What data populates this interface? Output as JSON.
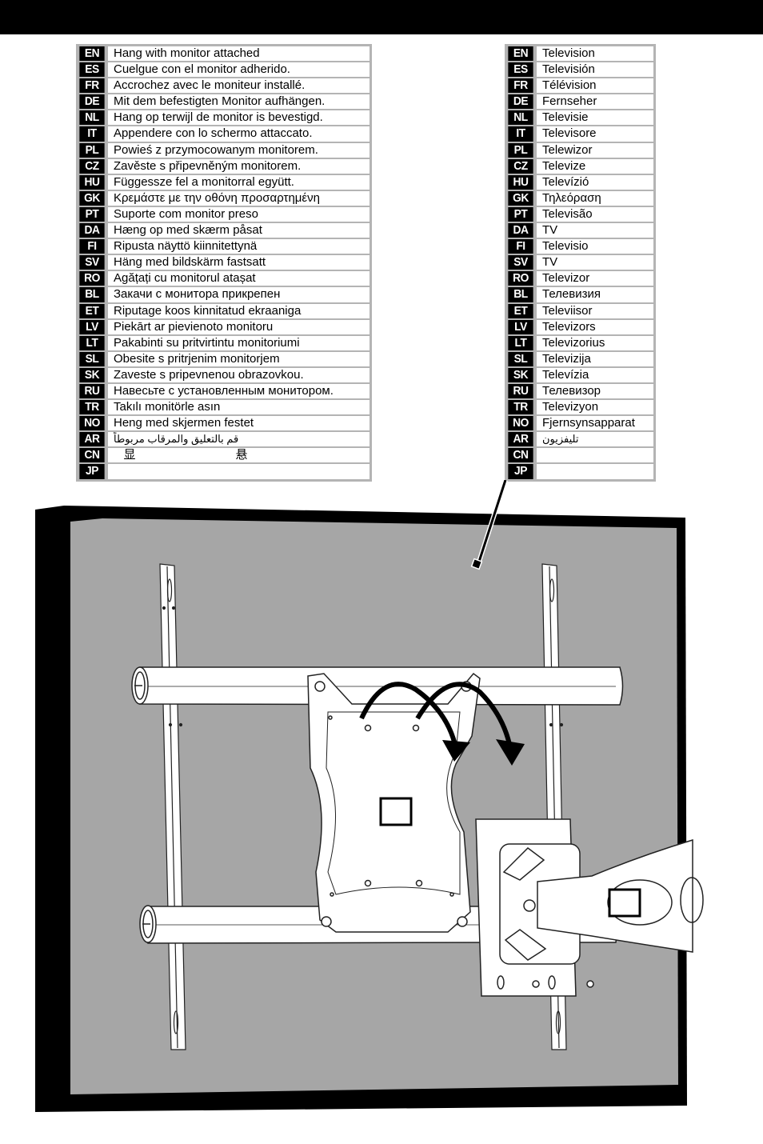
{
  "page": {
    "topbar_color": "#000000"
  },
  "left_table": {
    "title": "Hang with monitor attached",
    "rows": [
      {
        "code": "EN",
        "text": "Hang with monitor attached"
      },
      {
        "code": "ES",
        "text": "Cuelgue con el monitor adherido."
      },
      {
        "code": "FR",
        "text": "Accrochez avec le moniteur installé."
      },
      {
        "code": "DE",
        "text": "Mit dem befestigten Monitor aufhängen."
      },
      {
        "code": "NL",
        "text": "Hang op terwijl de monitor is bevestigd."
      },
      {
        "code": "IT",
        "text": "Appendere con lo schermo attaccato."
      },
      {
        "code": "PL",
        "text": "Powieś z przymocowanym monitorem."
      },
      {
        "code": "CZ",
        "text": "Zavěste s připevněným monitorem."
      },
      {
        "code": "HU",
        "text": "Függessze fel a monitorral együtt."
      },
      {
        "code": "GK",
        "text": "Κρεμάστε με την οθόνη προσαρτημένη"
      },
      {
        "code": "PT",
        "text": "Suporte com monitor preso"
      },
      {
        "code": "DA",
        "text": "Hæng op med skærm påsat"
      },
      {
        "code": "FI",
        "text": "Ripusta näyttö kiinnitettynä"
      },
      {
        "code": "SV",
        "text": "Häng med bildskärm fastsatt"
      },
      {
        "code": "RO",
        "text": "Agățați cu monitorul atașat"
      },
      {
        "code": "BL",
        "text": "Закачи с монитора прикрепен"
      },
      {
        "code": "ET",
        "text": "Riputage koos kinnitatud ekraaniga"
      },
      {
        "code": "LV",
        "text": "Piekārt ar pievienoto monitoru"
      },
      {
        "code": "LT",
        "text": "Pakabinti su pritvirtintu monitoriumi"
      },
      {
        "code": "SL",
        "text": "Obesite s pritrjenim monitorjem"
      },
      {
        "code": "SK",
        "text": "Zaveste s pripevnenou obrazovkou."
      },
      {
        "code": "RU",
        "text": "Навесьте с установленным монитором."
      },
      {
        "code": "TR",
        "text": "Takılı monitörle asın"
      },
      {
        "code": "NO",
        "text": "Heng med skjermen festet"
      },
      {
        "code": "AR",
        "text": "قم بالتعليق والمرقاب مربوطاً"
      },
      {
        "code": "CN",
        "text": "   显                              悬"
      },
      {
        "code": "JP",
        "text": ""
      }
    ]
  },
  "right_table": {
    "title": "Television",
    "rows": [
      {
        "code": "EN",
        "text": "Television"
      },
      {
        "code": "ES",
        "text": "Televisión"
      },
      {
        "code": "FR",
        "text": "Télévision"
      },
      {
        "code": "DE",
        "text": "Fernseher"
      },
      {
        "code": "NL",
        "text": "Televisie"
      },
      {
        "code": "IT",
        "text": "Televisore"
      },
      {
        "code": "PL",
        "text": "Telewizor"
      },
      {
        "code": "CZ",
        "text": "Televize"
      },
      {
        "code": "HU",
        "text": "Televízió"
      },
      {
        "code": "GK",
        "text": "Τηλεόραση"
      },
      {
        "code": "PT",
        "text": "Televisão"
      },
      {
        "code": "DA",
        "text": "TV"
      },
      {
        "code": "FI",
        "text": "Televisio"
      },
      {
        "code": "SV",
        "text": "TV"
      },
      {
        "code": "RO",
        "text": "Televizor"
      },
      {
        "code": "BL",
        "text": "Телевизия"
      },
      {
        "code": "ET",
        "text": "Televiisor"
      },
      {
        "code": "LV",
        "text": "Televizors"
      },
      {
        "code": "LT",
        "text": "Televizorius"
      },
      {
        "code": "SL",
        "text": "Televizija"
      },
      {
        "code": "SK",
        "text": "Televízia"
      },
      {
        "code": "RU",
        "text": "Телевизор"
      },
      {
        "code": "TR",
        "text": "Televizyon"
      },
      {
        "code": "NO",
        "text": "Fjernsynsapparat"
      },
      {
        "code": "AR",
        "text": "تليفزيون"
      },
      {
        "code": "CN",
        "text": ""
      },
      {
        "code": "JP",
        "text": ""
      }
    ]
  },
  "illustration": {
    "description": "Wall mount with monitor plate being hung onto rails; TV panel outline",
    "colors": {
      "tv_frame": "#000000",
      "tv_screen": "#a6a6a6",
      "hardware": "#ffffff",
      "outline": "#1a1a1a"
    },
    "callout_boxes": [
      "monitor-plate-label-box",
      "arm-label-box"
    ],
    "arrows": [
      "hang-arrow-left",
      "hang-arrow-right"
    ]
  }
}
